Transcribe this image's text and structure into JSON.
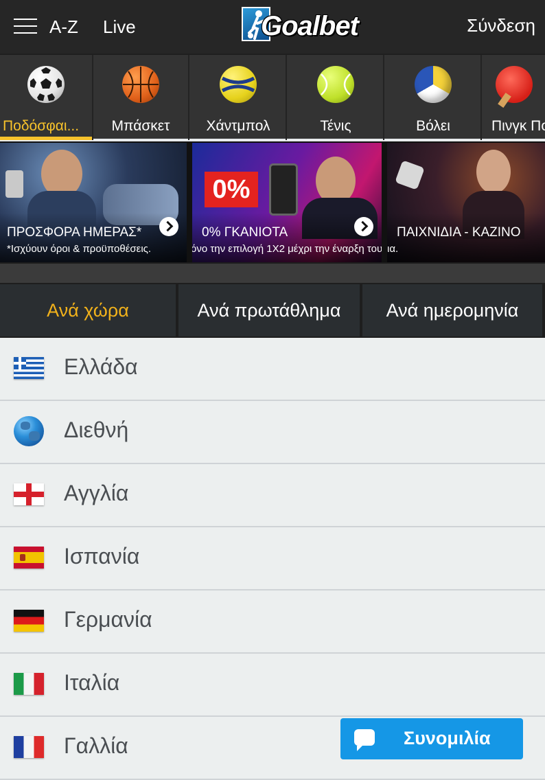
{
  "header": {
    "az_label": "A-Z",
    "live_label": "Live",
    "brand": "Goalbet",
    "login_label": "Σύνδεση"
  },
  "sports": [
    {
      "label": "Ποδόσφαι...",
      "icon": "soccer-ball-icon",
      "active": true
    },
    {
      "label": "Μπάσκετ",
      "icon": "basketball-icon",
      "active": false
    },
    {
      "label": "Χάντμπολ",
      "icon": "handball-icon",
      "active": false
    },
    {
      "label": "Τένις",
      "icon": "tennis-ball-icon",
      "active": false
    },
    {
      "label": "Βόλει",
      "icon": "volleyball-icon",
      "active": false
    },
    {
      "label": "Πινγκ Πο",
      "icon": "ping-pong-paddle-icon",
      "active": false
    }
  ],
  "promos": [
    {
      "title": "ΠΡΟΣΦΟΡΑ ΗΜΕΡΑΣ*",
      "subtitle": "*Ισχύουν όροι & προϋποθέσεις."
    },
    {
      "title": "0% ΓΚΑΝΙΟΤΑ",
      "subtitle": "όνο την επιλογή 1Χ2 μέχρι την έναρξη του",
      "badge": "0%"
    },
    {
      "title": "ΠΑΙΧΝΙΔΙΑ - ΚΑΖΙΝΟ",
      "subtitle": "ια."
    }
  ],
  "tabs": [
    {
      "label": "Ανά χώρα",
      "active": true
    },
    {
      "label": "Ανά πρωτάθλημα",
      "active": false
    },
    {
      "label": "Ανά ημερομηνία",
      "active": false
    }
  ],
  "countries": [
    {
      "name": "Ελλάδα",
      "flag": "greece-flag-icon"
    },
    {
      "name": "Διεθνή",
      "flag": "globe-icon"
    },
    {
      "name": "Αγγλία",
      "flag": "england-flag-icon"
    },
    {
      "name": "Ισπανία",
      "flag": "spain-flag-icon"
    },
    {
      "name": "Γερμανία",
      "flag": "germany-flag-icon"
    },
    {
      "name": "Ιταλία",
      "flag": "italy-flag-icon"
    },
    {
      "name": "Γαλλία",
      "flag": "france-flag-icon"
    }
  ],
  "chat": {
    "label": "Συνομιλία"
  },
  "colors": {
    "accent": "#f7c22b",
    "header_bg": "#262626",
    "chat_bg": "#1597e6",
    "list_bg": "#ecefef"
  }
}
